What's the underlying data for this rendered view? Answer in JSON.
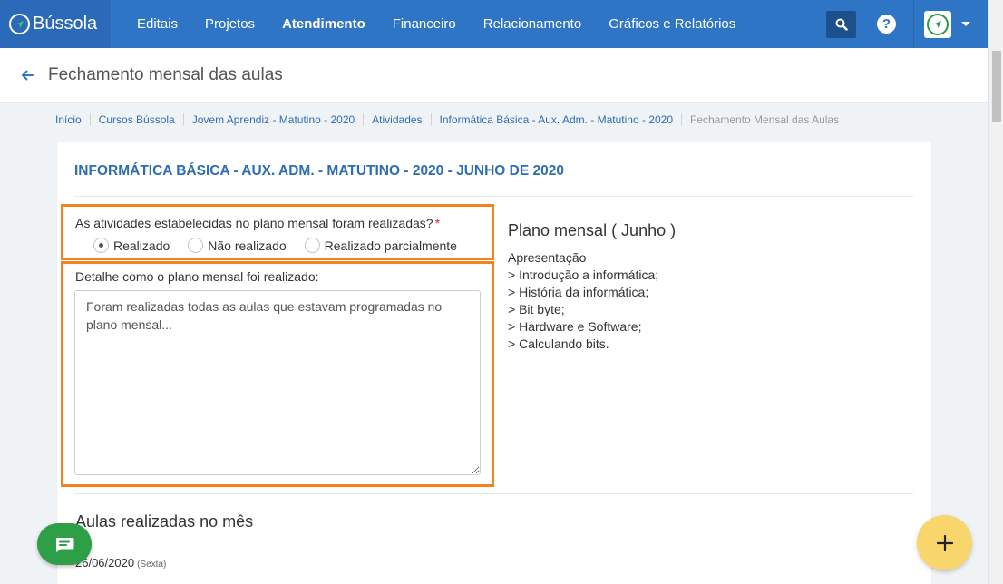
{
  "nav": {
    "brand": "Bússola",
    "items": [
      {
        "label": "Editais",
        "active": false
      },
      {
        "label": "Projetos",
        "active": false
      },
      {
        "label": "Atendimento",
        "active": true
      },
      {
        "label": "Financeiro",
        "active": false
      },
      {
        "label": "Relacionamento",
        "active": false
      },
      {
        "label": "Gráficos e Relatórios",
        "active": false
      }
    ],
    "help": "?"
  },
  "page": {
    "title": "Fechamento mensal das aulas"
  },
  "breadcrumb": [
    "Início",
    "Cursos Bússola",
    "Jovem Aprendiz - Matutino - 2020",
    "Atividades",
    "Informática Básica - Aux. Adm. - Matutino - 2020",
    "Fechamento Mensal das Aulas"
  ],
  "card": {
    "title": "INFORMÁTICA BÁSICA - AUX. ADM. - MATUTINO - 2020 - JUNHO DE 2020",
    "question": "As atividades estabelecidas no plano mensal foram realizadas?",
    "required_mark": "*",
    "options": [
      {
        "label": "Realizado",
        "selected": true
      },
      {
        "label": "Não realizado",
        "selected": false
      },
      {
        "label": "Realizado parcialmente",
        "selected": false
      }
    ],
    "detail_label": "Detalhe como o plano mensal foi realizado:",
    "detail_value": "Foram realizadas todas as aulas que estavam programadas no plano mensal...",
    "plan_title": "Plano mensal ( Junho )",
    "plan_items": [
      "Apresentação",
      "> Introdução a informática;",
      "> História da informática;",
      "> Bit byte;",
      "> Hardware e Software;",
      "> Calculando bits."
    ],
    "section_title": "Aulas realizadas no mês",
    "date": "26/06/2020",
    "weekday": "(Sexta)"
  },
  "colors": {
    "navbar": "#2f75c6",
    "highlight": "#f58220",
    "title": "#2d6db5",
    "chat_fab": "#2e9e47",
    "add_fab": "#f9d66b"
  },
  "fab": {
    "add": "+"
  }
}
